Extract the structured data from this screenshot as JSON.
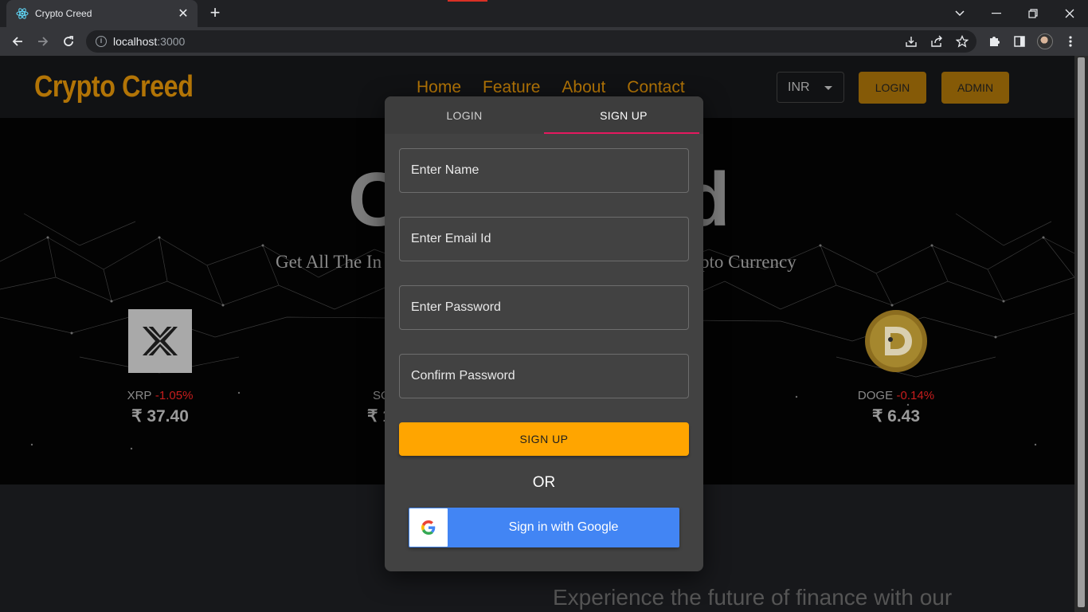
{
  "browser": {
    "tab_title": "Crypto Creed",
    "url_host": "localhost",
    "url_port": ":3000"
  },
  "site": {
    "logo": "Crypto Creed",
    "nav": [
      "Home",
      "Feature",
      "About",
      "Contact"
    ],
    "currency": "INR",
    "login_button": "LOGIN",
    "admin_button": "ADMIN"
  },
  "hero": {
    "title_left": "C",
    "title_right": "d",
    "subtitle_left": "Get All The In",
    "subtitle_right": "pto Currency",
    "coins": [
      {
        "name": "XRP",
        "change": "-1.05%",
        "price": "₹ 37.40"
      },
      {
        "name": "SO",
        "change": "",
        "price": "₹ 1"
      },
      {
        "name": "DOGE",
        "change": "-0.14%",
        "price": "₹ 6.43"
      }
    ]
  },
  "lower": {
    "text": "Experience the future of finance with our"
  },
  "modal": {
    "tab_login": "LOGIN",
    "tab_signup": "SIGN UP",
    "active_tab": "signup",
    "fields": {
      "name_placeholder": "Enter Name",
      "email_placeholder": "Enter Email Id",
      "password_placeholder": "Enter Password",
      "confirm_placeholder": "Confirm Password"
    },
    "signup_button": "SIGN UP",
    "or_text": "OR",
    "google_button": "Sign in with Google"
  },
  "colors": {
    "brand": "#b27406",
    "signup_button": "#ffa500",
    "tab_indicator": "#e5195f",
    "google_blue": "#4285f4",
    "negative_change": "#c81d1d"
  }
}
